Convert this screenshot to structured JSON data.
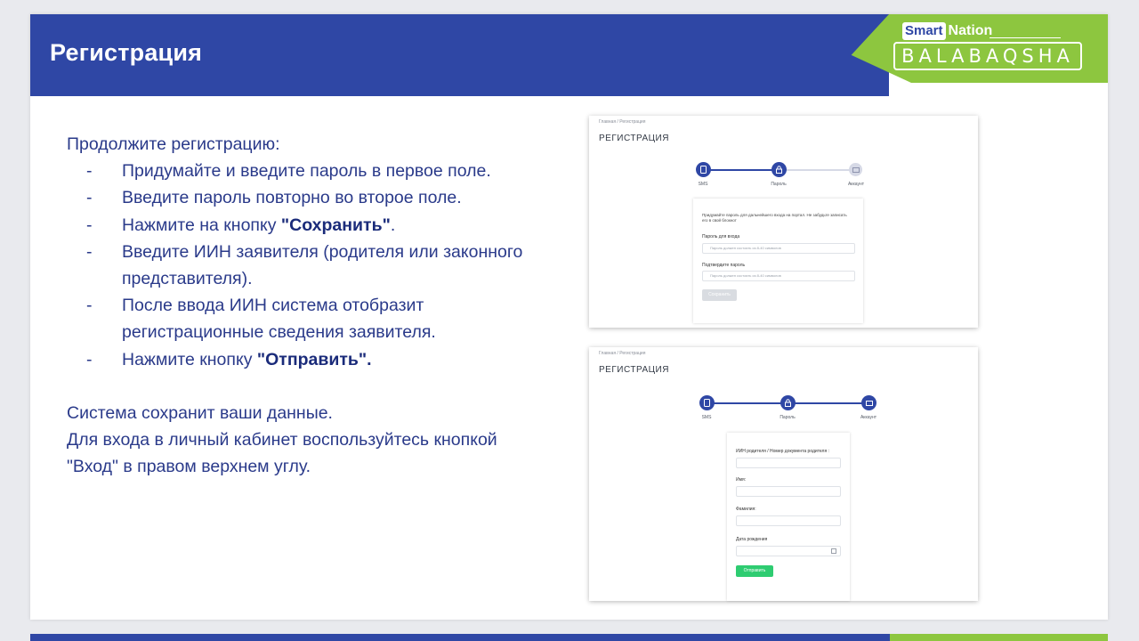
{
  "slide": {
    "title": "Регистрация",
    "logo": {
      "top_left": "Smart",
      "top_right": "Nation",
      "bottom": "BALABAQSHA"
    },
    "colors": {
      "banner_blue": "#2f47a5",
      "banner_green": "#8dc63f",
      "text_blue": "#2a3a8a"
    }
  },
  "instructions": {
    "intro": "Продолжите регистрацию:",
    "dash": "-",
    "steps": [
      "Придумайте и введите пароль в первое поле.",
      "Введите пароль повторно во второе поле.",
      {
        "before": "Нажмите на кнопку ",
        "bold": "\"Сохранить\"",
        "after": "."
      },
      "Введите ИИН заявителя (родителя или законного представителя).",
      "После ввода ИИН система отобразит регистрационные сведения заявителя.",
      {
        "before": "Нажмите кнопку ",
        "bold": "\"Отправить\".",
        "after": ""
      }
    ],
    "outro_1": "Система сохранит ваши данные.",
    "outro_2": "Для входа в личный кабинет воспользуйтесь кнопкой \"Вход\" в правом верхнем углу."
  },
  "screenshot_1": {
    "breadcrumb": "Главная  /  Регистрация",
    "title": "РЕГИСТРАЦИЯ",
    "steps": [
      "SMS",
      "Пароль",
      "Аккаунт"
    ],
    "note": "Придумайте пароль для дальнейшего входа на портал. Не забудьте записать его в свой блокнот",
    "password_label": "Пароль для входа",
    "password_placeholder": "Пароль должен состоять из 8-40 символов",
    "confirm_label": "Подтвердите пароль",
    "confirm_placeholder": "Пароль должен состоять из 8-40 символов",
    "save_button": "Сохранить"
  },
  "screenshot_2": {
    "breadcrumb": "Главная  /  Регистрация",
    "title": "РЕГИСТРАЦИЯ",
    "steps": [
      "SMS",
      "Пароль",
      "Аккаунт"
    ],
    "iin_label": "ИИН родителя / Номер документа родителя :",
    "name_label": "Имя:",
    "surname_label": "Фамилия:",
    "dob_label": "Дата рождения",
    "submit_button": "Отправить"
  }
}
